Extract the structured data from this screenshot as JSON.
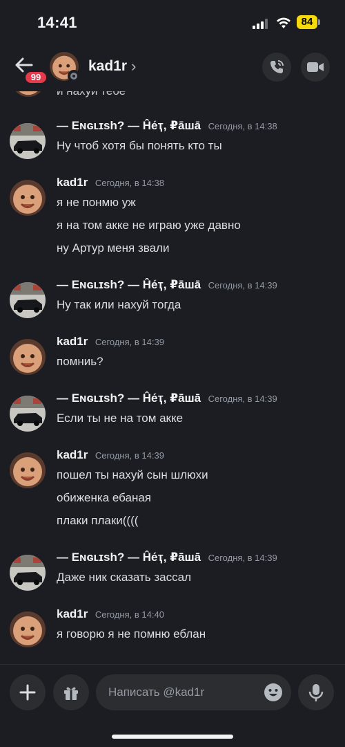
{
  "status_bar": {
    "time": "14:41",
    "battery": "84",
    "battery_color": "#f5d90a"
  },
  "header": {
    "unread_count": "99",
    "name": "kad1r",
    "chevron": "›",
    "icons": [
      "back-arrow-icon",
      "phone-call-icon",
      "video-camera-icon"
    ],
    "status_color": "#80848e",
    "badge_color": "#e5394c"
  },
  "partial_top_text": "и нахуй тебе",
  "messages": [
    {
      "author": "— Eɴɢʟɪsh? — Ĥе́ҭ, ₽ā̄шā",
      "time": "Сегодня, в 14:38",
      "avatar": "car",
      "lines": [
        "Ну чтоб хотя бы понять кто ты"
      ]
    },
    {
      "author": "kad1r",
      "time": "Сегодня, в 14:38",
      "avatar": "baby",
      "lines": [
        "я не понмю уж",
        "я на том акке не играю уже давно",
        "ну Артур меня звали"
      ]
    },
    {
      "author": "— Eɴɢʟɪsh? — Ĥе́ҭ, ₽ā̄шā",
      "time": "Сегодня, в 14:39",
      "avatar": "car",
      "lines": [
        "Ну так или нахуй тогда"
      ]
    },
    {
      "author": "kad1r",
      "time": "Сегодня, в 14:39",
      "avatar": "baby",
      "lines": [
        "помниь?"
      ]
    },
    {
      "author": "— Eɴɢʟɪsh? — Ĥе́ҭ, ₽ā̄шā",
      "time": "Сегодня, в 14:39",
      "avatar": "car",
      "lines": [
        "Если ты не на том акке"
      ]
    },
    {
      "author": "kad1r",
      "time": "Сегодня, в 14:39",
      "avatar": "baby",
      "lines": [
        "пошел ты нахуй сын шлюхи",
        "обиженка ебаная",
        "плаки плаки(((("
      ]
    },
    {
      "author": "— Eɴɢʟɪsh? — Ĥе́ҭ, ₽ā̄шā",
      "time": "Сегодня, в 14:39",
      "avatar": "car",
      "lines": [
        "Даже ник сказать зассал"
      ]
    },
    {
      "author": "kad1r",
      "time": "Сегодня, в 14:40",
      "avatar": "baby",
      "lines": [
        "я говорю я не помню еблан"
      ]
    }
  ],
  "composer": {
    "placeholder": "Написать @kad1r",
    "icons": [
      "plus-icon",
      "gift-icon",
      "emoji-icon",
      "microphone-icon"
    ]
  },
  "colors": {
    "background": "#1c1d22",
    "surface": "#2b2d31",
    "text": "#dbdee1",
    "muted": "#949ba4"
  }
}
